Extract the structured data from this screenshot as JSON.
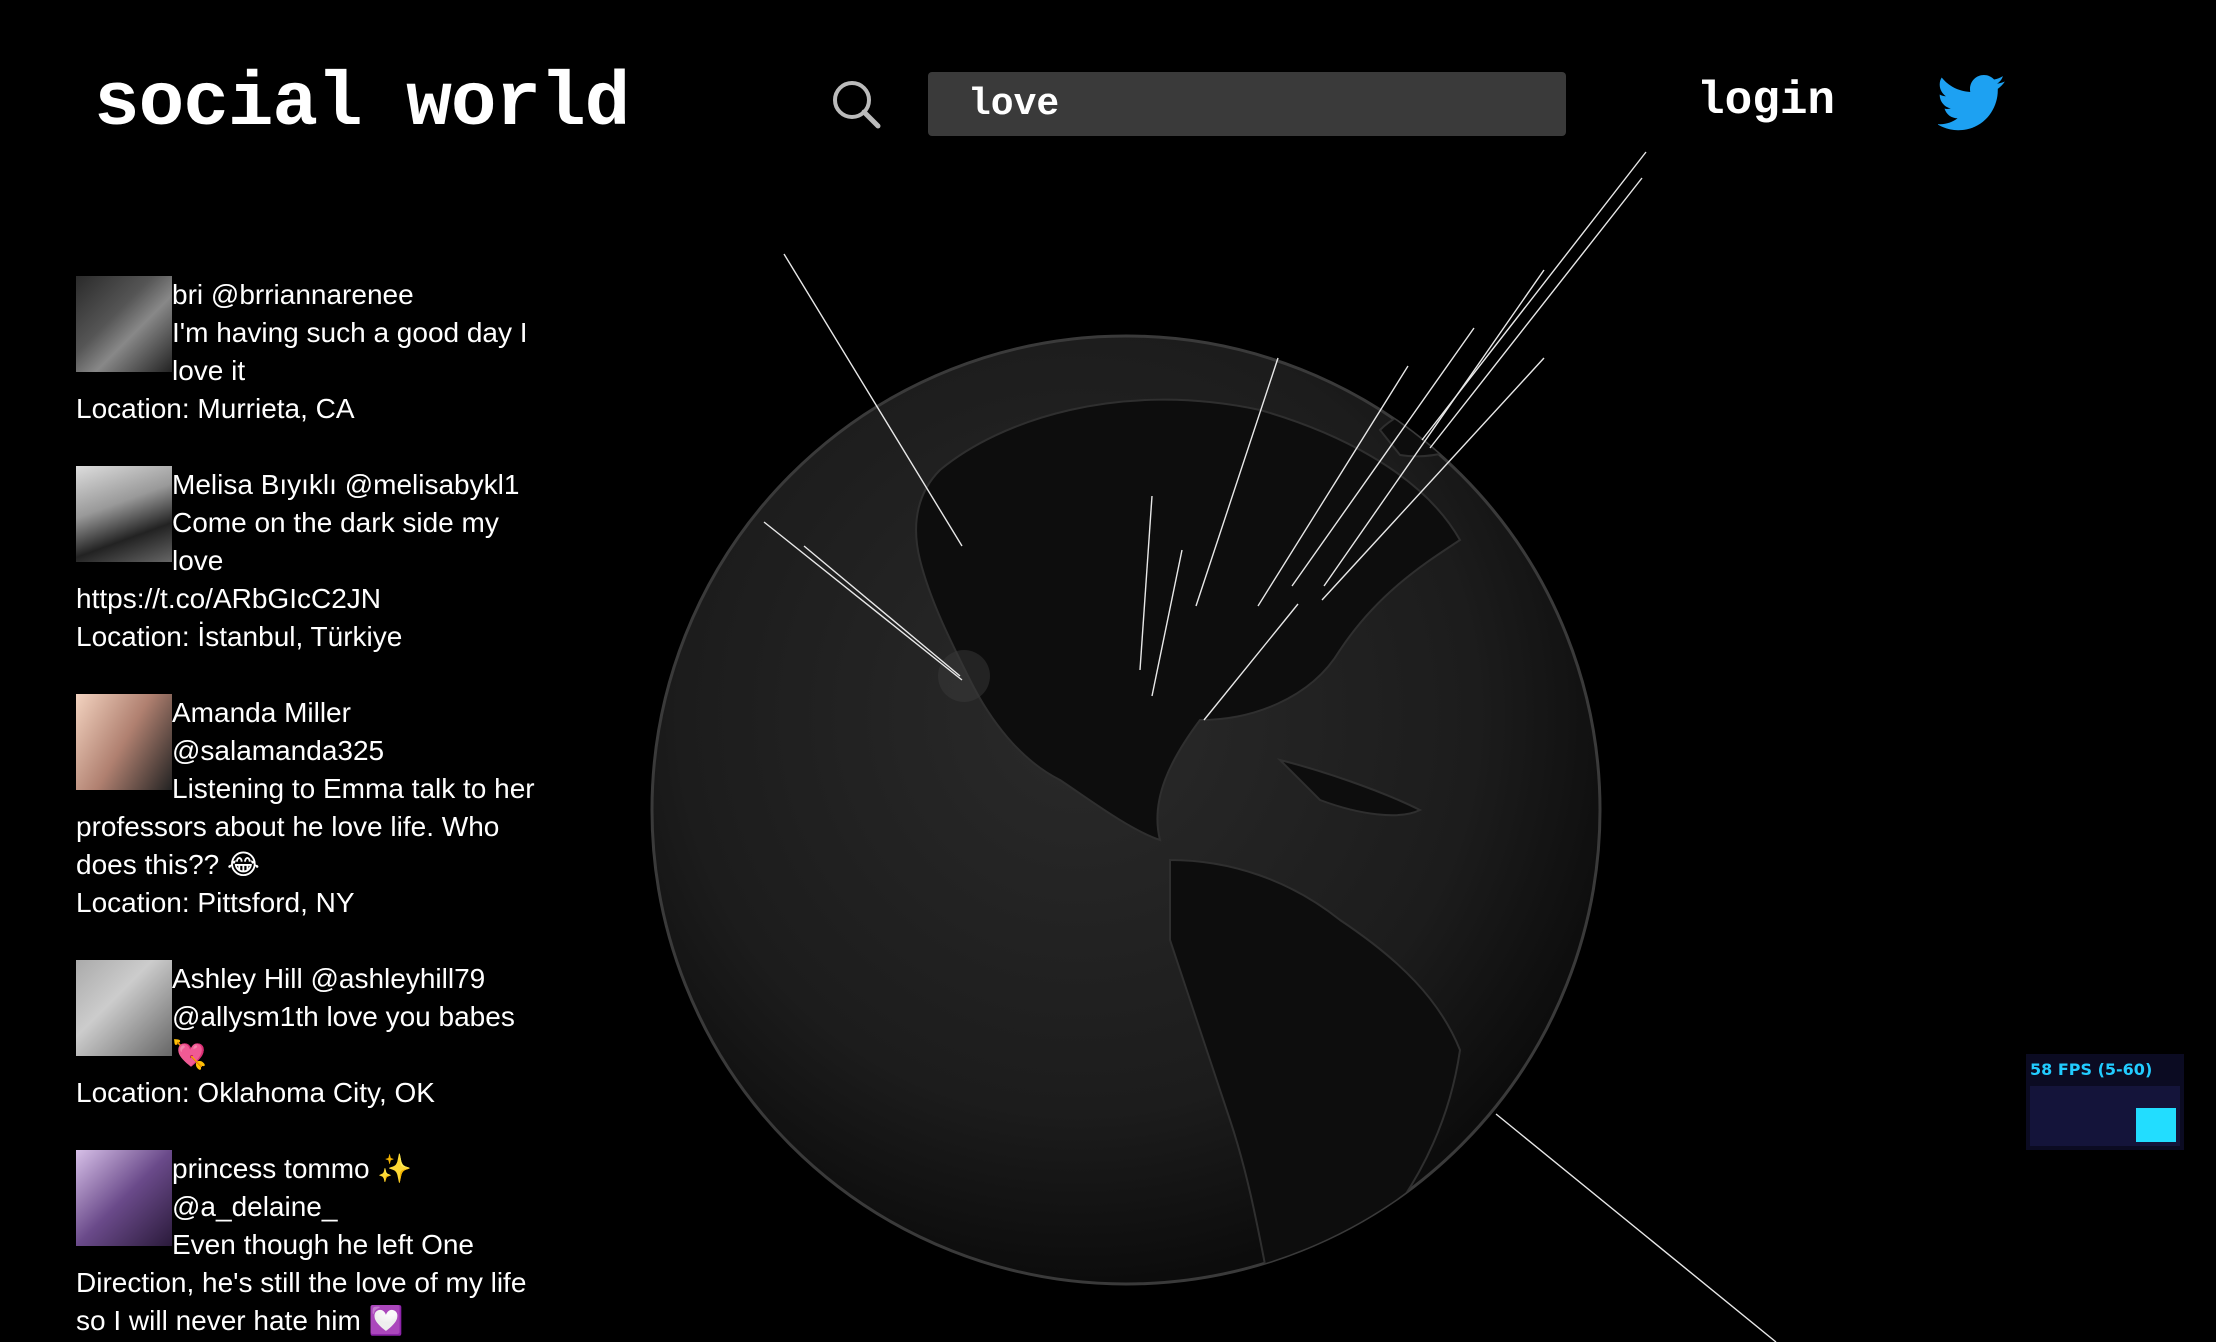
{
  "header": {
    "brand": "social world",
    "search_value": "love",
    "login_label": "login"
  },
  "feed": [
    {
      "name_line": "bri @brriannarenee",
      "text": "I'm having such a good day I love it",
      "location_label": "Location:",
      "location": "Murrieta, CA"
    },
    {
      "name_line": "Melisa Bıyıklı @melisabykl1",
      "text": "Come on the dark side my love https://t.co/ARbGIcC2JN",
      "location_label": "Location:",
      "location": "İstanbul, Türkiye"
    },
    {
      "name_line": "Amanda Miller @salamanda325",
      "text": "Listening to Emma talk to her professors about he love life. Who does this?? 😂",
      "location_label": "Location:",
      "location": "Pittsford, NY"
    },
    {
      "name_line": "Ashley Hill @ashleyhill79",
      "text": "@allysm1th love you babes 💘",
      "location_label": "Location:",
      "location": "Oklahoma City, OK"
    },
    {
      "name_line": "princess tommo ✨ @a_delaine_",
      "text": "Even though he left One Direction, he's still the love of my life so I will never hate him 💟",
      "location_label": "",
      "location": ""
    }
  ],
  "fps": {
    "label": "58 FPS (5-60)",
    "level": 0.57
  },
  "colors": {
    "twitter_blue": "#1da1f2",
    "fps_text": "#22ccff"
  }
}
